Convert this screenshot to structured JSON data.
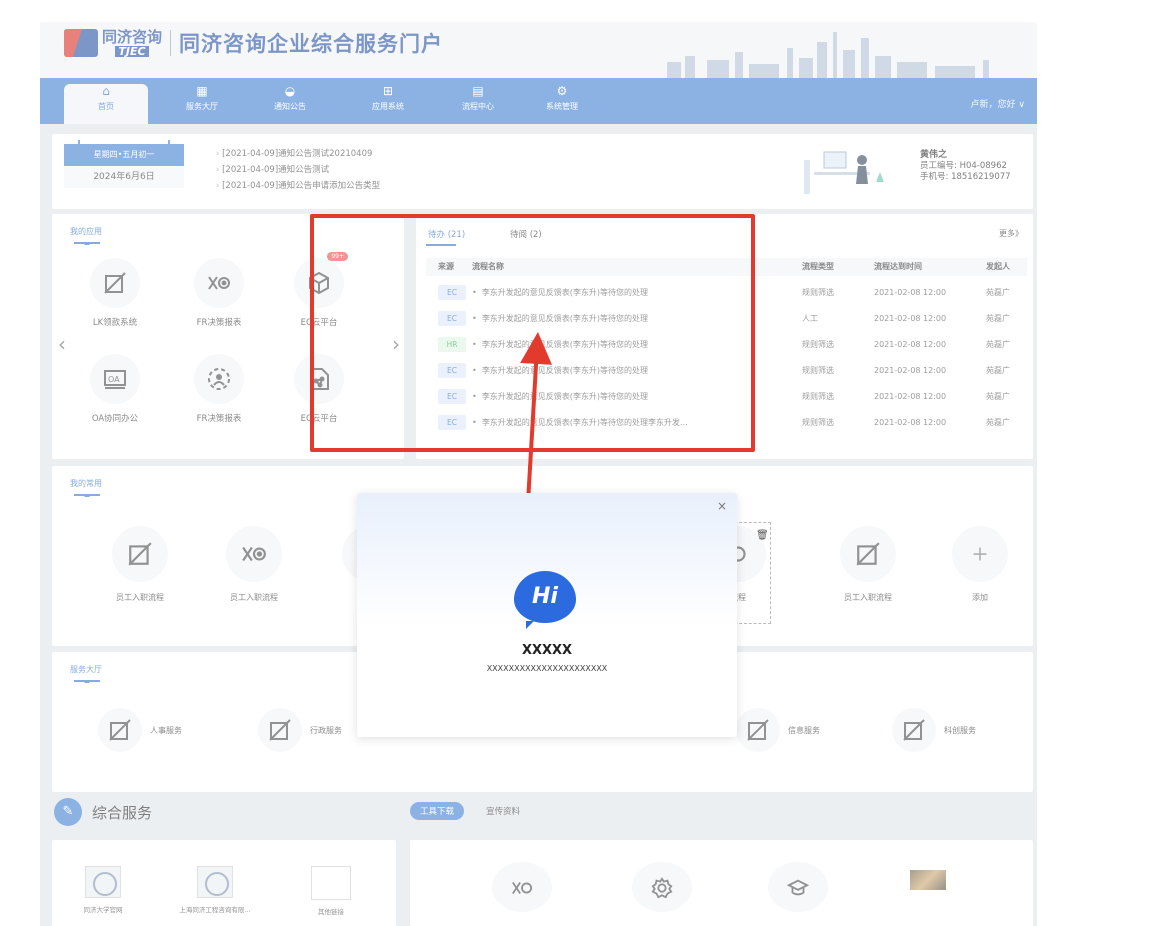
{
  "header": {
    "logo_cn": "同济咨询",
    "logo_en": "TJEC",
    "title": "同济咨询企业综合服务门户"
  },
  "nav": {
    "items": [
      {
        "label": "首页",
        "icon": "home-icon"
      },
      {
        "label": "服务大厅",
        "icon": "grid-icon"
      },
      {
        "label": "通知公告",
        "icon": "bell-icon"
      },
      {
        "label": "应用系统",
        "icon": "apps-icon"
      },
      {
        "label": "流程中心",
        "icon": "flow-icon"
      },
      {
        "label": "系统管理",
        "icon": "settings-icon"
      }
    ],
    "user": "卢新，您好 ∨"
  },
  "notice": {
    "weekday": "星期四•五月初一",
    "date": "2024年6月6日",
    "items": [
      "[2021-04-09]通知公告测试20210409",
      "[2021-04-09]通知公告测试",
      "[2021-04-09]通知公告申请添加公告类型"
    ]
  },
  "profile": {
    "name": "黄伟之",
    "emp_no": "员工编号: H04-08962",
    "phone": "手机号: 18516219077"
  },
  "apps": {
    "title": "我的应用",
    "items": [
      {
        "label": "LK领款系统",
        "icon": "slash-square-icon"
      },
      {
        "label": "FR决策报表",
        "icon": "fr-icon"
      },
      {
        "label": "EC云平台",
        "icon": "cube-icon",
        "badge": "99+"
      },
      {
        "label": "OA协同办公",
        "icon": "oa-icon"
      },
      {
        "label": "FR决策报表",
        "icon": "users-circle-icon"
      },
      {
        "label": "EC云平台",
        "icon": "network-icon"
      }
    ]
  },
  "todo": {
    "tab1": "待办 (21)",
    "tab2": "待阅 (2)",
    "more": "更多》",
    "headers": [
      "来源",
      "流程名称",
      "流程类型",
      "流程达到时间",
      "发起人"
    ],
    "rows": [
      {
        "src": "EC",
        "name": "李东升发起的意见反馈表(李东升)等待您的处理",
        "type": "规则筛选",
        "time": "2021-02-08 12:00",
        "by": "苑磊广"
      },
      {
        "src": "EC",
        "name": "李东升发起的意见反馈表(李东升)等待您的处理",
        "type": "人工",
        "time": "2021-02-08 12:00",
        "by": "苑磊广"
      },
      {
        "src": "HR",
        "name": "李东升发起的意见反馈表(李东升)等待您的处理",
        "type": "规则筛选",
        "time": "2021-02-08 12:00",
        "by": "苑磊广"
      },
      {
        "src": "EC",
        "name": "李东升发起的意见反馈表(李东升)等待您的处理",
        "type": "规则筛选",
        "time": "2021-02-08 12:00",
        "by": "苑磊广"
      },
      {
        "src": "EC",
        "name": "李东升发起的意见反馈表(李东升)等待您的处理",
        "type": "规则筛选",
        "time": "2021-02-08 12:00",
        "by": "苑磊广"
      },
      {
        "src": "EC",
        "name": "李东升发起的意见反馈表(李东升)等待您的处理李东升发...",
        "type": "规则筛选",
        "time": "2021-02-08 12:00",
        "by": "苑磊广"
      }
    ]
  },
  "common": {
    "title": "我的常用",
    "items": [
      "员工入职流程",
      "员工入职流程",
      "员工",
      "流程",
      "员工入职流程",
      "添加"
    ]
  },
  "service": {
    "title": "服务大厅",
    "items": [
      "人事服务",
      "行政服务",
      "信息服务",
      "科创服务"
    ]
  },
  "composite": {
    "title": "综合服务",
    "tab_on": "工具下载",
    "tab_off": "宣传资料",
    "left_items": [
      "同济大学官网",
      "上海同济工程咨询有限...",
      "其他链接"
    ]
  },
  "modal": {
    "name": "XXXXX",
    "sub": "XXXXXXXXXXXXXXXXXXXXXX",
    "hi": "Hi",
    "close": "×"
  },
  "colors": {
    "primary": "#3a7bd0",
    "highlight": "#e23b2e",
    "badge": "#e84545"
  }
}
